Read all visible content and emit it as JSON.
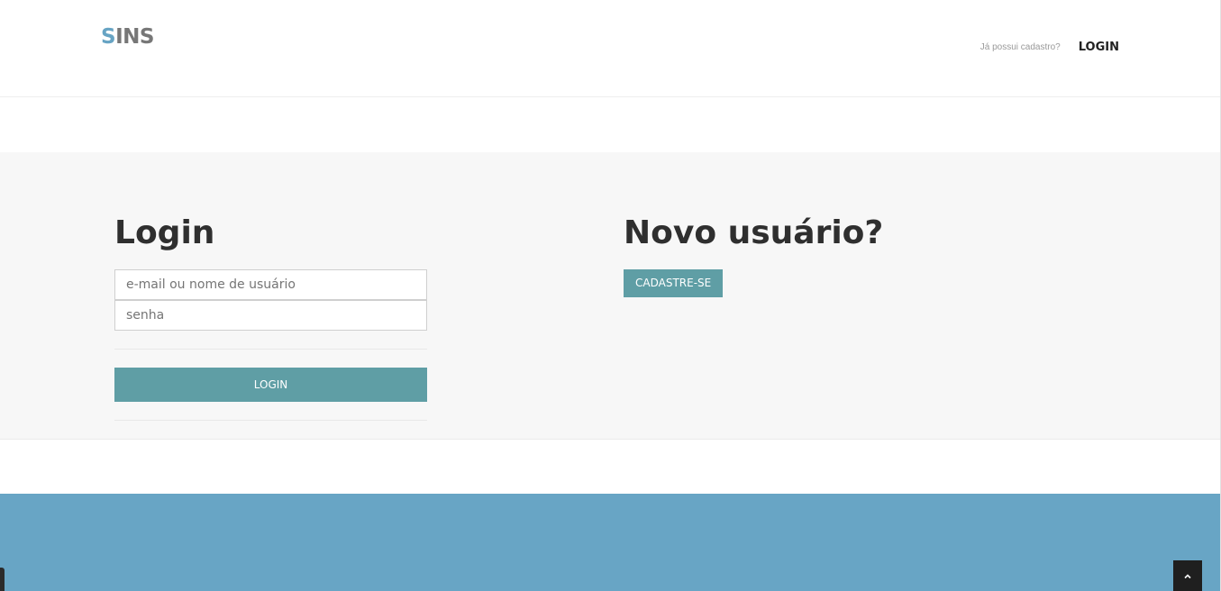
{
  "header": {
    "logo_accent": "S",
    "logo_rest": "INS",
    "already_registered": "Já possui cadastro?",
    "login_link": "LOGIN"
  },
  "login": {
    "title": "Login",
    "username_placeholder": "e-mail ou nome de usuário",
    "password_placeholder": "senha",
    "button": "LOGIN"
  },
  "signup": {
    "title": "Novo usuário?",
    "button": "CADASTRE-SE"
  },
  "footer": {
    "scroll_top_icon": "chevron-up-icon"
  },
  "colors": {
    "accent": "#67a4c4",
    "button": "#5f9ea5",
    "footer": "#68a5c5"
  }
}
